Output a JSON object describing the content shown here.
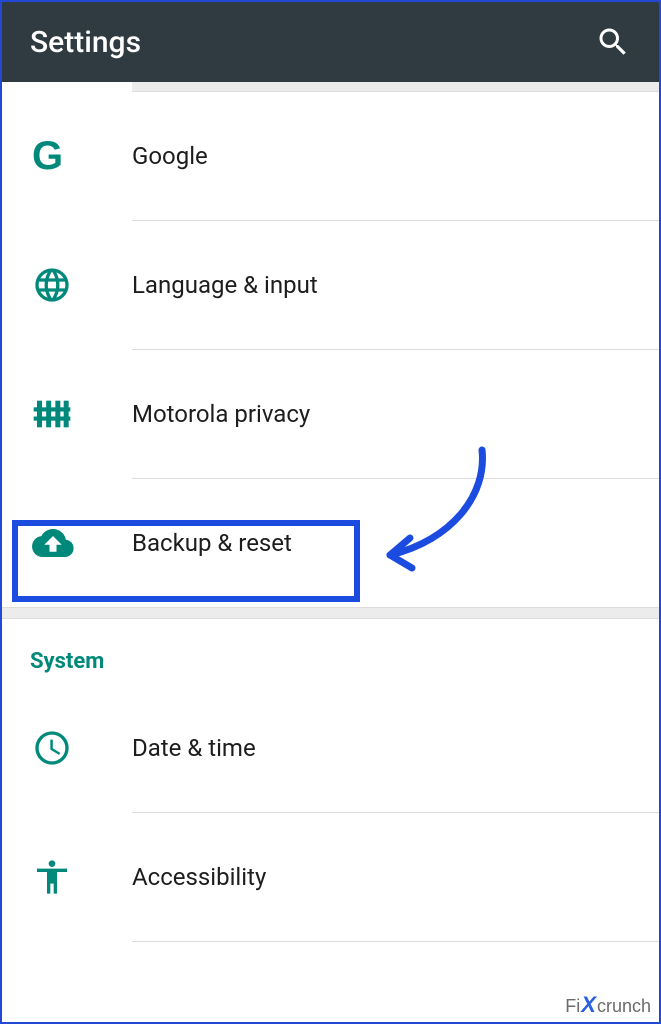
{
  "header": {
    "title": "Settings"
  },
  "items": [
    {
      "label": "Google"
    },
    {
      "label": "Language & input"
    },
    {
      "label": "Motorola privacy"
    },
    {
      "label": "Backup & reset"
    }
  ],
  "section": {
    "title": "System"
  },
  "system_items": [
    {
      "label": "Date & time"
    },
    {
      "label": "Accessibility"
    }
  ],
  "watermark": {
    "pre": "Fi",
    "post": "crunch"
  }
}
